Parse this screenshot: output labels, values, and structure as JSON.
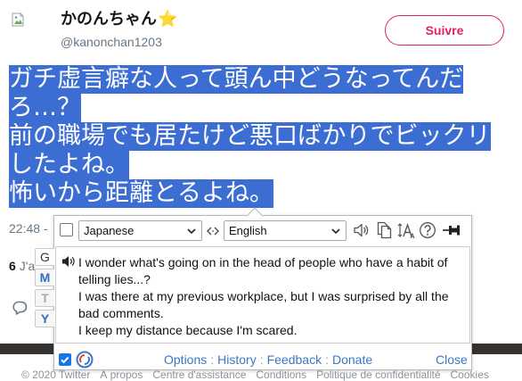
{
  "tweet": {
    "author": {
      "name": "かのんちゃん",
      "emoji": "⭐",
      "handle": "@kanonchan1203",
      "avatar_icon": "broken-image-icon"
    },
    "follow_label": "Suivre",
    "text_lines": [
      "ガチ虚言癖な人って頭ん中どうなってんだ",
      "ろ…？",
      "前の職場でも居たけど悪口ばかりでビックリ",
      "したよね。",
      "怖いから距離とるよね。"
    ],
    "timestamp": "22:48 -",
    "likes_count": "6",
    "likes_label": "J'a",
    "reply_icon": "reply-icon"
  },
  "translator": {
    "toolbar_checkbox_checked": false,
    "source_lang": "Japanese",
    "target_lang": "English",
    "icons": {
      "swap": "swap-icon",
      "speak": "speaker-icon",
      "copy": "copy-icon",
      "font_size": "font-size-icon",
      "help": "help-icon",
      "pin": "pin-icon",
      "result_speak": "speaker-icon",
      "logo": "imtranslator-logo-icon"
    },
    "tabs": [
      {
        "label": "G",
        "color": "#333333",
        "active": true
      },
      {
        "label": "M",
        "color": "#2f6fc0",
        "active": false
      },
      {
        "label": "T",
        "color": "#a8a8a8",
        "active": false
      },
      {
        "label": "Y",
        "color": "#2f6fc0",
        "active": false
      }
    ],
    "result_paragraphs": [
      "I wonder what's going on in the head of people who have a habit of telling lies...?",
      "I was there at my previous workplace, but I was surprised by all the bad comments.",
      "I keep my distance because I'm scared."
    ],
    "footer_checkbox_checked": true,
    "links": [
      "Options",
      "History",
      "Feedback",
      "Donate"
    ],
    "link_separator": ":",
    "close_label": "Close"
  },
  "footer": {
    "links": [
      "© 2020 Twitter",
      "À propos",
      "Centre d'assistance",
      "Conditions",
      "Politique de confidentialité",
      "Cookies"
    ]
  },
  "colors": {
    "selection": "#3b6dd3",
    "follow": "#e0245e",
    "star": "#f5a623",
    "muted": "#657786",
    "link": "#3a77c2",
    "footer": "#8b959e",
    "media_strip": "#35322f",
    "checkbox": "#1a73e8"
  }
}
